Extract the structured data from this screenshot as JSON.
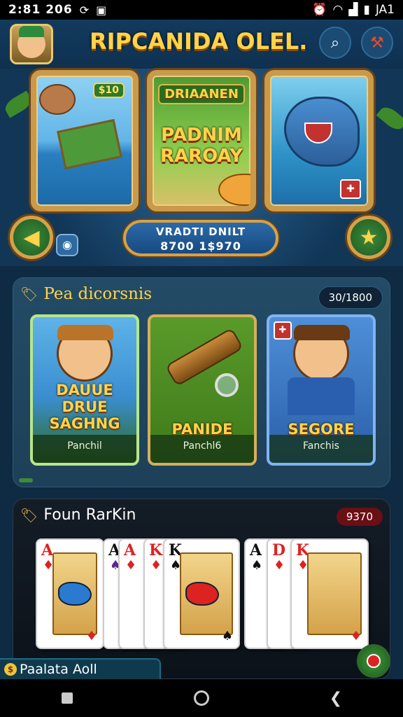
{
  "status_bar": {
    "time": "2:81 206",
    "icons": [
      "sync-icon",
      "image-icon",
      "alarm-icon",
      "wifi-icon",
      "signal-icon",
      "battery-icon"
    ],
    "right_text": "JA1"
  },
  "header": {
    "title": "RIPCANIDA OLEL.",
    "search_icon": "search-icon",
    "settings_icon": "hammer-icon"
  },
  "hero": {
    "banner1_badge": "$10",
    "banner2_top": "DRIAANEN",
    "banner2_main": "PADNIM RAROAY",
    "promo_line1": "VRADTI DNILT",
    "promo_line2": "8700 1$970",
    "prev_icon": "triangle-left-icon",
    "next_icon": "star-icon"
  },
  "section1": {
    "title": "Pea dicorsnis",
    "badge": "30/1800",
    "cards": [
      {
        "name": "DAUUE DRUE SAGHNG",
        "sub": "Panchil"
      },
      {
        "name": "PANIDE",
        "sub": "Panchl6"
      },
      {
        "name": "SEGORE",
        "sub": "Fanchis"
      }
    ]
  },
  "section2": {
    "title": "Foun RarKin",
    "badge": "9370",
    "cards": [
      {
        "rank": "A",
        "suit": "♦",
        "color": "red"
      },
      {
        "rank": "A",
        "suit": "♠",
        "color": "blk"
      },
      {
        "rank": "A",
        "suit": "♦",
        "color": "red"
      },
      {
        "rank": "K",
        "suit": "♦",
        "color": "red"
      },
      {
        "rank": "K",
        "suit": "♠",
        "color": "blk"
      },
      {
        "rank": "A",
        "suit": "♠",
        "color": "blk"
      },
      {
        "rank": "D",
        "suit": "♦",
        "color": "red"
      },
      {
        "rank": "K",
        "suit": "♦",
        "color": "red"
      }
    ]
  },
  "bottom_strip": {
    "label": "Paalata Aoll"
  },
  "colors": {
    "gold": "#ffd34a",
    "wood": "#c89a4a",
    "bg": "#0f2a43"
  }
}
